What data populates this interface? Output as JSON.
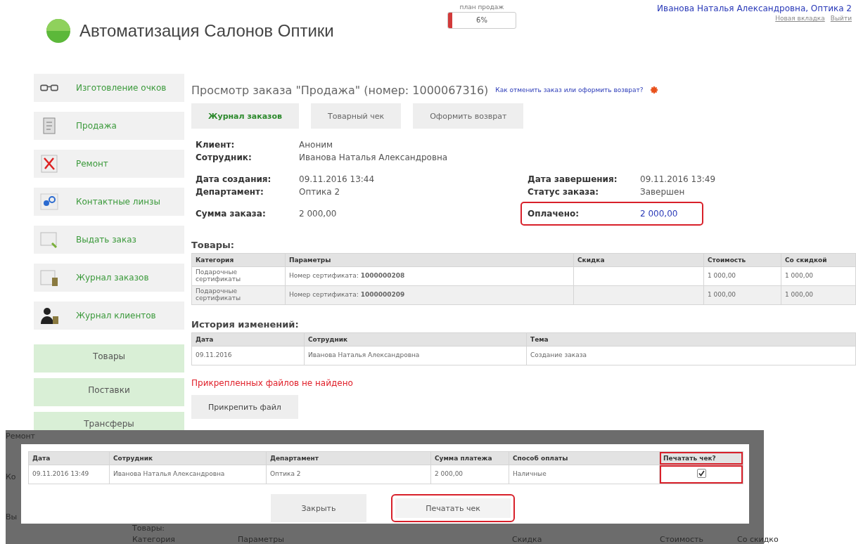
{
  "header": {
    "title": "Автоматизация Салонов Оптики",
    "sales_plan": {
      "label": "план продаж",
      "level": 0.06,
      "reading": "6%"
    },
    "user": "Иванова Наталья Александровна, Оптика 2",
    "links": [
      "Новая вкладка",
      "Выйти"
    ]
  },
  "sidebar": {
    "items": [
      {
        "kind": "module",
        "label": "Изготовление очков"
      },
      {
        "kind": "module",
        "label": "Продажа"
      },
      {
        "kind": "module",
        "label": "Ремонт"
      },
      {
        "kind": "module",
        "label": "Контактные линзы"
      },
      {
        "kind": "module",
        "label": "Выдать заказ"
      },
      {
        "kind": "module",
        "label": "Журнал заказов"
      },
      {
        "kind": "module",
        "label": "Журнал клиентов"
      },
      {
        "kind": "section",
        "label": "Товары"
      },
      {
        "kind": "section",
        "label": "Поставки"
      },
      {
        "kind": "section",
        "label": "Трансферы"
      }
    ]
  },
  "order": {
    "title": "Просмотр заказа \"Продажа\" (номер: 1000067316)",
    "help_link": "Как отменить заказ или оформить возврат?",
    "tabs": [
      {
        "label": "Журнал заказов",
        "selected": true
      },
      {
        "label": "Товарный чек",
        "selected": false
      },
      {
        "label": "Оформить возврат",
        "selected": false
      }
    ],
    "fields_left": [
      [
        {
          "label": "Клиент:",
          "value": "Аноним"
        },
        {
          "label": "Сотрудник:",
          "value": "Иванова Наталья Александровна"
        }
      ],
      [
        {
          "label": "Дата создания:",
          "value": "09.11.2016 13:44"
        },
        {
          "label": "Департамент:",
          "value": "Оптика 2"
        }
      ],
      [
        {
          "label": "Сумма заказа:",
          "value": "2 000,00"
        }
      ]
    ],
    "fields_right": [
      [
        {
          "label": "Дата завершения:",
          "value": "09.11.2016 13:49"
        },
        {
          "label": "Статус заказа:",
          "value": "Завершен"
        }
      ],
      [
        {
          "label": "Оплачено:",
          "value": "2 000,00",
          "highlighted": true
        }
      ]
    ],
    "goods": {
      "title": "Товары:",
      "columns": [
        "Категория",
        "Параметры",
        "Скидка",
        "Стоимость",
        "Со скидкой"
      ],
      "rows": [
        [
          "Подарочные сертификаты",
          "Номер сертификата: **1000000208**",
          "",
          "1 000,00",
          "1 000,00"
        ],
        [
          "Подарочные сертификаты",
          "Номер сертификата: **1000000209**",
          "",
          "1 000,00",
          "1 000,00"
        ]
      ]
    },
    "history": {
      "title": "История изменений:",
      "columns": [
        "Дата",
        "Сотрудник",
        "Тема"
      ],
      "rows": [
        [
          "09.11.2016",
          "Иванова Наталья Александровна",
          "Создание заказа"
        ]
      ]
    },
    "attachments_message": "Прикрепленных файлов не найдено",
    "attach_button": "Прикрепить файл"
  },
  "payment_dialog": {
    "background_texts": [
      "Ремонт",
      "Ко",
      "Вы",
      "Товары:",
      "Категория",
      "Параметры",
      "Скидка",
      "Стоимость",
      "Со скидко"
    ],
    "columns": [
      "Дата",
      "Сотрудник",
      "Департамент",
      "Сумма платежа",
      "Способ оплаты",
      "Печатать чек?"
    ],
    "rows": [
      {
        "date": "09.11.2016 13:49",
        "employee": "Иванова Наталья Александровна",
        "department": "Оптика 2",
        "amount": "2 000,00",
        "method": "Наличные",
        "print_receipt": true
      }
    ],
    "print_column_highlighted": true,
    "buttons": [
      {
        "label": "Закрыть",
        "highlighted": false
      },
      {
        "label": "Печатать чек",
        "highlighted": true
      }
    ]
  }
}
